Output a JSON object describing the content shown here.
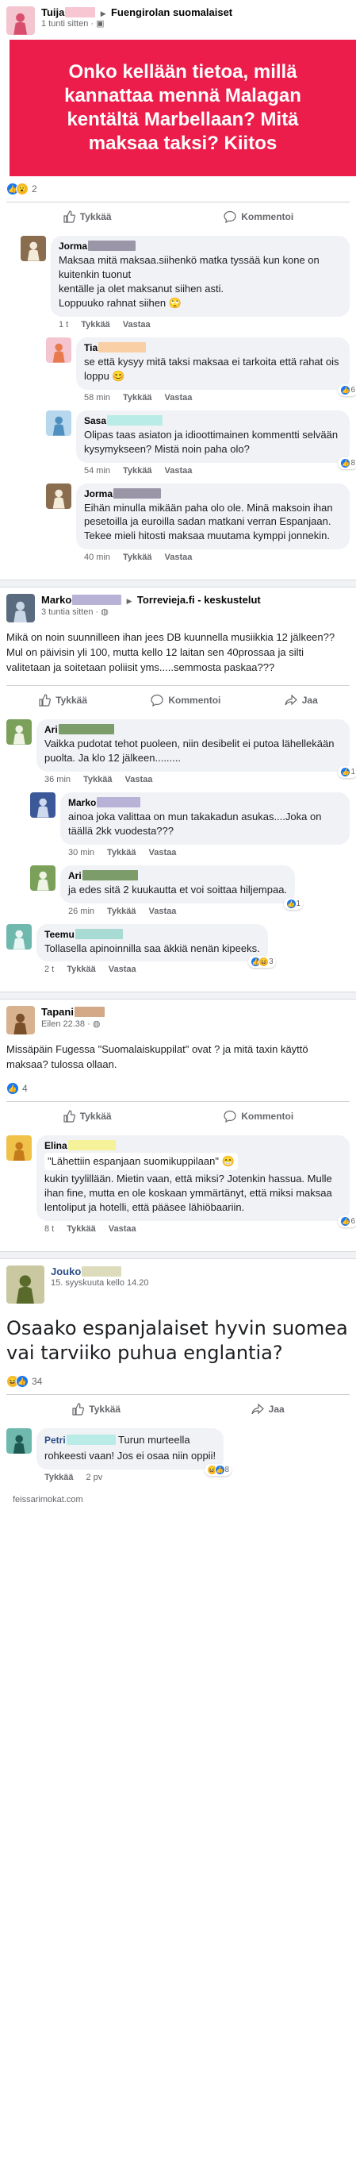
{
  "icons": {
    "like": "like-thumb-icon",
    "comment": "comment-bubble-icon",
    "share": "share-arrow-icon",
    "globe": "globe-icon",
    "group": "group-icon"
  },
  "colors": {
    "banner": "#ec1d4b",
    "like": "#1877f2"
  },
  "post1": {
    "author": "Tuija",
    "group": "Fuengirolan suomalaiset",
    "time": "1 tunti sitten · ",
    "banner_text": "Onko kellään tietoa, millä kannattaa mennä Malagan kentältä Marbellaan? Mitä maksaa taksi? Kiitos",
    "reaction_count": "2",
    "like_label": "Tykkää",
    "comment_label": "Kommentoi",
    "comments": [
      {
        "name": "Jorma",
        "text": "Maksaa mitä maksaa.siihenkö matka tyssää kun kone on kuitenkin tuonut\nkentälle ja olet maksanut  siihen asti.\nLoppuuko rahnat siihen 🙄",
        "time": "1 t",
        "like": "Tykkää",
        "reply": "Vastaa",
        "reactions": ""
      },
      {
        "name": "Tia",
        "text": "se että kysyy mitä taksi maksaa ei tarkoita että rahat ois loppu 😊",
        "time": "58 min",
        "like": "Tykkää",
        "reply": "Vastaa",
        "reactions": "6"
      },
      {
        "name": "Sasa",
        "text": "Olipas taas asiaton ja idioottimainen kommentti selvään kysymykseen? Mistä noin paha olo?",
        "time": "54 min",
        "like": "Tykkää",
        "reply": "Vastaa",
        "reactions": "8"
      },
      {
        "name": "Jorma",
        "text": "Eihän minulla mikään paha olo ole. Minä maksoin ihan pesetoilla ja euroilla sadan matkani verran Espanjaan. Tekee mieli hitosti maksaa muutama kymppi jonnekin.",
        "time": "40 min",
        "like": "Tykkää",
        "reply": "Vastaa",
        "reactions": ""
      }
    ]
  },
  "post2": {
    "author": "Marko",
    "group": "Torrevieja.fi - keskustelut",
    "time": "3 tuntia sitten · ",
    "text": "Mikä on noin suunnilleen ihan jees DB kuunnella musiikkia 12 jälkeen??Mul on päivisin yli 100, mutta kello 12 laitan sen 40prossaa ja silti valitetaan ja soitetaan poliisit yms.....semmosta paskaa???",
    "like_label": "Tykkää",
    "comment_label": "Kommentoi",
    "share_label": "Jaa",
    "comments": [
      {
        "name": "Ari",
        "text": "Vaikka pudotat tehot puoleen, niin desibelit ei putoa lähellekään puolta. Ja klo 12 jälkeen.........",
        "time": "36 min",
        "like": "Tykkää",
        "reply": "Vastaa",
        "reactions": "1"
      },
      {
        "name": "Marko",
        "text": "ainoa joka valittaa on mun takakadun asukas....Joka on täällä 2kk vuodesta???",
        "time": "30 min",
        "like": "Tykkää",
        "reply": "Vastaa",
        "reactions": ""
      },
      {
        "name": "Ari",
        "text": "ja edes sitä 2 kuukautta et voi soittaa hiljempaa.",
        "time": "26 min",
        "like": "Tykkää",
        "reply": "Vastaa",
        "reactions": "1"
      },
      {
        "name": "Teemu",
        "text": "Tollasella apinoinnilla saa äkkiä nenän kipeeks.",
        "time": "2 t",
        "like": "Tykkää",
        "reply": "Vastaa",
        "reactions": "3"
      }
    ]
  },
  "post3": {
    "author": "Tapani",
    "time": "Eilen 22.38 · ",
    "text": "Missäpäin Fugessa  \"Suomalaiskuppilat\" ovat ? ja mitä taxin käyttö maksaa?  tulossa ollaan.",
    "reaction_count": "4",
    "like_label": "Tykkää",
    "comment_label": "Kommentoi",
    "comment": {
      "name": "Elina",
      "quote": "\"Lähettiin espanjaan suomikuppilaan\" 😁",
      "text": "kukin tyylillään. Mietin vaan, että miksi? Jotenkin hassua. Mulle ihan fine, mutta en ole koskaan ymmärtänyt, että miksi maksaa lentoliput ja hotelli, että pääsee lähiöbaariin.",
      "time": "8 t",
      "like": "Tykkää",
      "reply": "Vastaa",
      "reactions": "6"
    }
  },
  "post4": {
    "author": "Jouko",
    "time": "15. syyskuuta kello 14.20",
    "text": "Osaako espanjalaiset hyvin suomea vai tarviiko puhua englantia?",
    "reaction_count": "34",
    "like_label": "Tykkää",
    "share_label": "Jaa",
    "comment": {
      "name": "Petri",
      "text_inline": "Turun murteella",
      "text": "rohkeesti vaan! Jos ei osaa niin oppii!",
      "time": "2 pv",
      "like": "Tykkää",
      "reactions": "8"
    }
  },
  "watermark": "feissarimokat.com"
}
